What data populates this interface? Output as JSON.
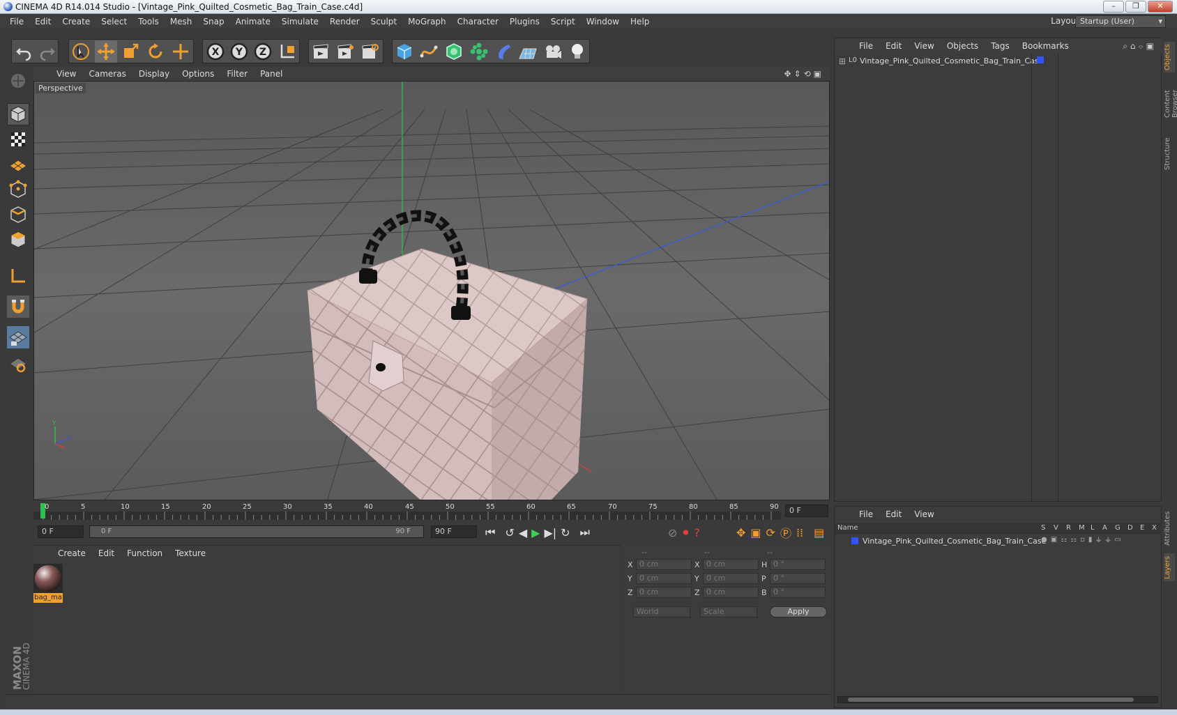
{
  "window": {
    "title": "CINEMA 4D R14.014 Studio - [Vintage_Pink_Quilted_Cosmetic_Bag_Train_Case.c4d]",
    "min": "–",
    "max": "❐",
    "close": "✕"
  },
  "menu": [
    "File",
    "Edit",
    "Create",
    "Select",
    "Tools",
    "Mesh",
    "Snap",
    "Animate",
    "Simulate",
    "Render",
    "Sculpt",
    "MoGraph",
    "Character",
    "Plugins",
    "Script",
    "Window",
    "Help"
  ],
  "layout": {
    "label": "Layout:",
    "value": "Startup (User)"
  },
  "viewport": {
    "menu": [
      "View",
      "Cameras",
      "Display",
      "Options",
      "Filter",
      "Panel"
    ],
    "label": "Perspective",
    "axis_y": "Y",
    "axis_z": "Z"
  },
  "timeline": {
    "ticks": [
      "0",
      "5",
      "10",
      "15",
      "20",
      "25",
      "30",
      "35",
      "40",
      "45",
      "50",
      "55",
      "60",
      "65",
      "70",
      "75",
      "80",
      "85",
      "90"
    ],
    "current_frame": "0 F",
    "start_field": "0 F",
    "range_start": "0 F",
    "range_end": "90 F",
    "end_field": "90 F"
  },
  "material_manager": {
    "menu": [
      "Create",
      "Edit",
      "Function",
      "Texture"
    ],
    "materials": [
      {
        "name": "bag_ma"
      }
    ]
  },
  "coordinates": {
    "headers": [
      "--",
      "--",
      "--"
    ],
    "rows": [
      {
        "a": "X",
        "av": "0 cm",
        "b": "X",
        "bv": "0 cm",
        "c": "H",
        "cv": "0 °"
      },
      {
        "a": "Y",
        "av": "0 cm",
        "b": "Y",
        "bv": "0 cm",
        "c": "P",
        "cv": "0 °"
      },
      {
        "a": "Z",
        "av": "0 cm",
        "b": "Z",
        "bv": "0 cm",
        "c": "B",
        "cv": "0 °"
      }
    ],
    "mode1": "World",
    "mode2": "Scale",
    "apply": "Apply"
  },
  "object_manager": {
    "menu": [
      "File",
      "Edit",
      "View",
      "Objects",
      "Tags",
      "Bookmarks"
    ],
    "objects": [
      {
        "name": "Vintage_Pink_Quilted_Cosmetic_Bag_Train_Case",
        "color": "#3355ff"
      }
    ]
  },
  "layer_manager": {
    "menu": [
      "File",
      "Edit",
      "View"
    ],
    "col_name": "Name",
    "flags": [
      "S",
      "V",
      "R",
      "M",
      "L",
      "A",
      "G",
      "D",
      "E",
      "X"
    ],
    "layers": [
      {
        "name": "Vintage_Pink_Quilted_Cosmetic_Bag_Train_Case",
        "color": "#3355ff"
      }
    ]
  },
  "side_tabs": [
    "Objects",
    "Content Browser",
    "Structure",
    "Attributes",
    "Layers"
  ],
  "branding": {
    "maxon": "MAXON",
    "product": "CINEMA 4D"
  },
  "colors": {
    "accent": "#f0a030",
    "axis_y": "#2fbf4f",
    "axis_x": "#d04040",
    "axis_z": "#3a5ad8",
    "bag": "#d9c2c2"
  }
}
